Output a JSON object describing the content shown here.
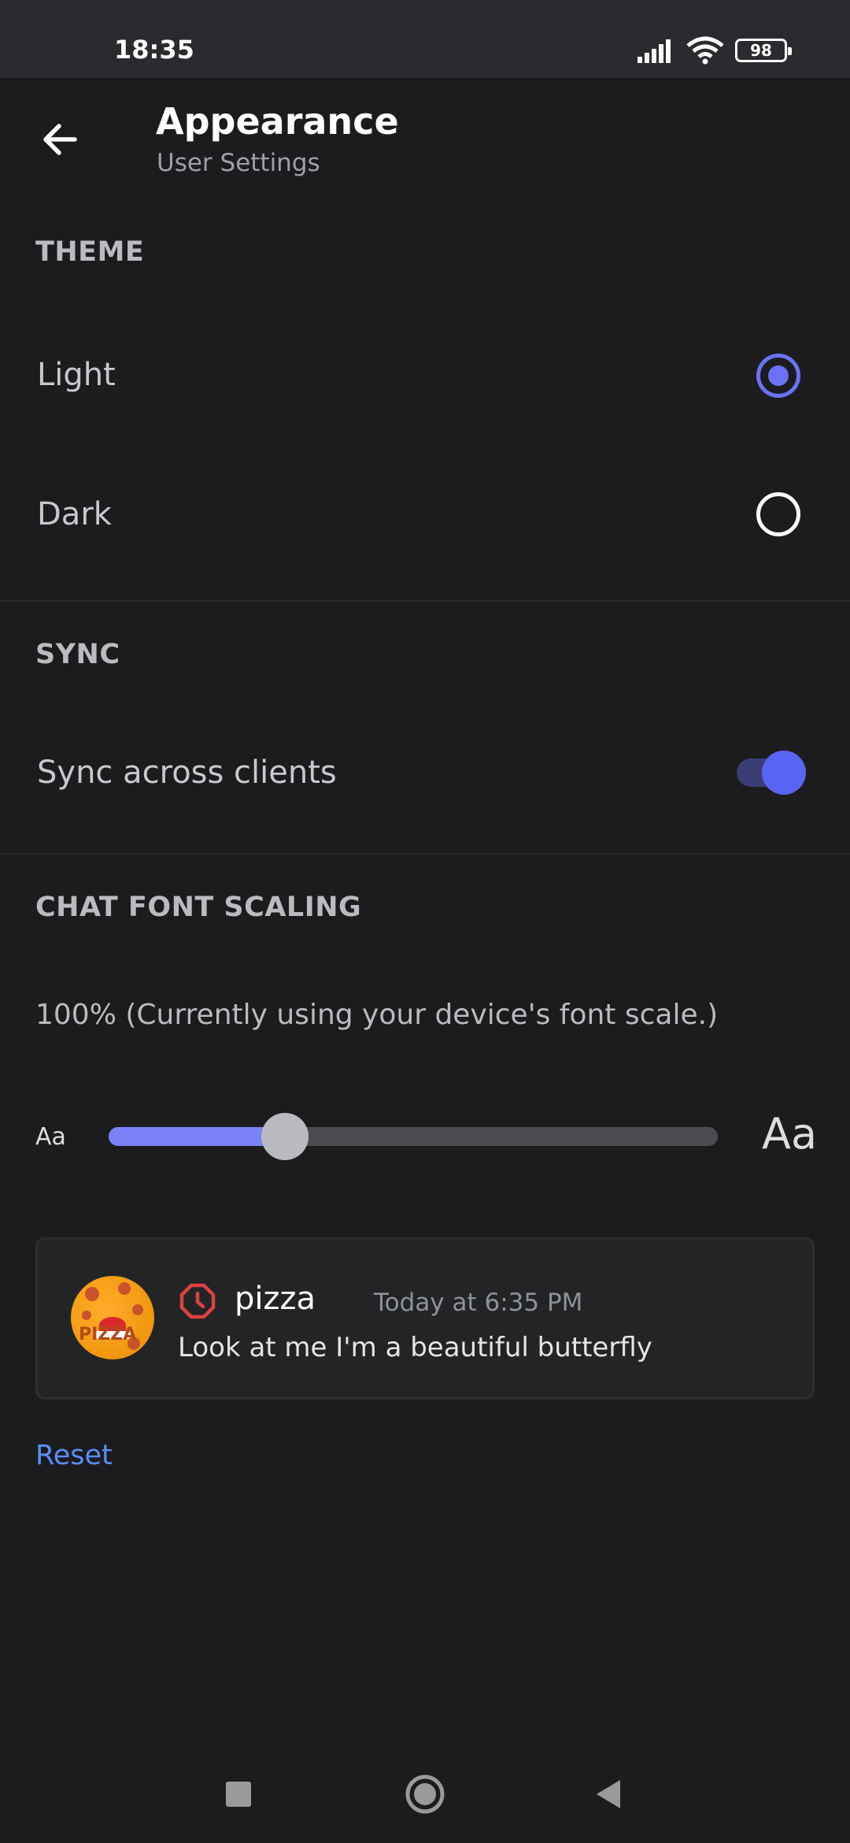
{
  "status_bar": {
    "time": "18:35",
    "battery": "98",
    "icons": [
      "signal-icon",
      "wifi-icon",
      "battery-icon"
    ]
  },
  "header": {
    "title": "Appearance",
    "subtitle": "User Settings",
    "back_icon": "arrow-left-icon"
  },
  "theme": {
    "section_title": "THEME",
    "options": [
      {
        "label": "Light",
        "selected": true
      },
      {
        "label": "Dark",
        "selected": false
      }
    ]
  },
  "sync": {
    "section_title": "SYNC",
    "label": "Sync across clients",
    "enabled": true
  },
  "font_scaling": {
    "section_title": "CHAT FONT SCALING",
    "description": "100% (Currently using your device's font scale.)",
    "small_label": "Aa",
    "large_label": "Aa",
    "slider_value": 0.29
  },
  "preview": {
    "username": "pizza",
    "timestamp": "Today at 6:35 PM",
    "message": "Look at me I'm a beautiful butterfly",
    "avatar_text": "PIZZA"
  },
  "reset_label": "Reset",
  "colors": {
    "accent": "#5865f2",
    "background": "#1c1c1e",
    "link": "#5b8ef6"
  },
  "navigation_bar": {
    "buttons": [
      "recents-square-icon",
      "home-circle-icon",
      "back-triangle-icon"
    ]
  }
}
